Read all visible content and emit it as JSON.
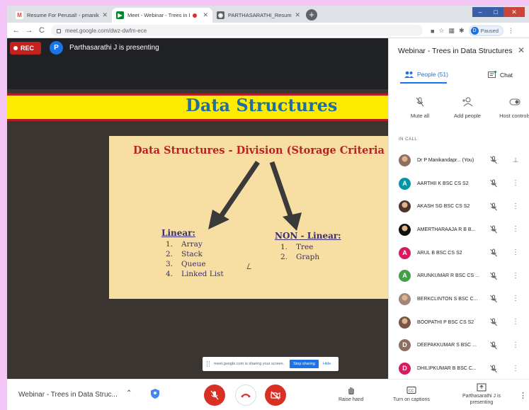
{
  "browser": {
    "tabs": [
      {
        "title": "Resume For Perusal! - pmanikan...",
        "favicon_color": "#ea4335",
        "favicon_glyph": "M",
        "active": false
      },
      {
        "title": "Meet - Webinar - Trees in D...",
        "favicon_color": "#00832d",
        "favicon_glyph": "▶",
        "active": true
      },
      {
        "title": "PARTHASARATHI_Resume_2020...",
        "favicon_color": "#5f6368",
        "favicon_glyph": "◉",
        "active": false
      }
    ],
    "url": "meet.google.com/dwz-dwfm-ece",
    "profile_initial": "D",
    "profile_status": "Paused"
  },
  "stage": {
    "rec_label": "REC",
    "presenter_initial": "P",
    "presenter_text": "Parthasarathi J is presenting"
  },
  "slide": {
    "title": "Data Structures",
    "subtitle": "Data Structures -  Division (Storage Criteria",
    "linear": {
      "heading": "Linear:",
      "items": [
        {
          "n": "1.",
          "label": "Array"
        },
        {
          "n": "2.",
          "label": "Stack"
        },
        {
          "n": "3.",
          "label": "Queue"
        },
        {
          "n": "4.",
          "label": "Linked List"
        }
      ]
    },
    "nonlinear": {
      "heading": "NON - Linear:",
      "items": [
        {
          "n": "1.",
          "label": "Tree"
        },
        {
          "n": "2.",
          "label": "Graph"
        }
      ]
    }
  },
  "share_bar": {
    "text": "meet.google.com is sharing your screen.",
    "stop_label": "Stop sharing",
    "hide_label": "Hide"
  },
  "panel": {
    "title": "Webinar - Trees in Data Structures",
    "tab_people": "People (51)",
    "tab_chat": "Chat",
    "actions": {
      "mute_all": "Mute all",
      "add_people": "Add people",
      "host_controls": "Host controls"
    },
    "in_call_label": "IN CALL",
    "participants": [
      {
        "name": "Dr P Manikandapr...  (You)",
        "avatar": "",
        "color": "#8d6e63",
        "photo": true
      },
      {
        "name": "AARTHII K BSC CS S2",
        "avatar": "A",
        "color": "#0097a7",
        "photo": false
      },
      {
        "name": "AKASH SG BSC CS S2",
        "avatar": "",
        "color": "#4e342e",
        "photo": true
      },
      {
        "name": "AMERTHARAAJA R B B...",
        "avatar": "",
        "color": "#111111",
        "photo": true
      },
      {
        "name": "ARUL B BSC CS S2",
        "avatar": "A",
        "color": "#d81b60",
        "photo": false
      },
      {
        "name": "ARUNKUMAR R BSC CS ...",
        "avatar": "A",
        "color": "#43a047",
        "photo": false
      },
      {
        "name": "BERKCLINTON S BSC C...",
        "avatar": "",
        "color": "#a1887f",
        "photo": true
      },
      {
        "name": "BOOPATHI P BSC CS S2",
        "avatar": "",
        "color": "#795548",
        "photo": true
      },
      {
        "name": "DEEPAKKUMAR S BSC ...",
        "avatar": "D",
        "color": "#8d6e63",
        "photo": false
      },
      {
        "name": "DHILIPKUMAR B BSC C...",
        "avatar": "D",
        "color": "#d81b60",
        "photo": false
      }
    ]
  },
  "bottom": {
    "meeting_name": "Webinar - Trees in Data Struc...",
    "raise_hand": "Raise hand",
    "captions": "Turn on captions",
    "presenting": "Parthasarathi J is presenting"
  }
}
